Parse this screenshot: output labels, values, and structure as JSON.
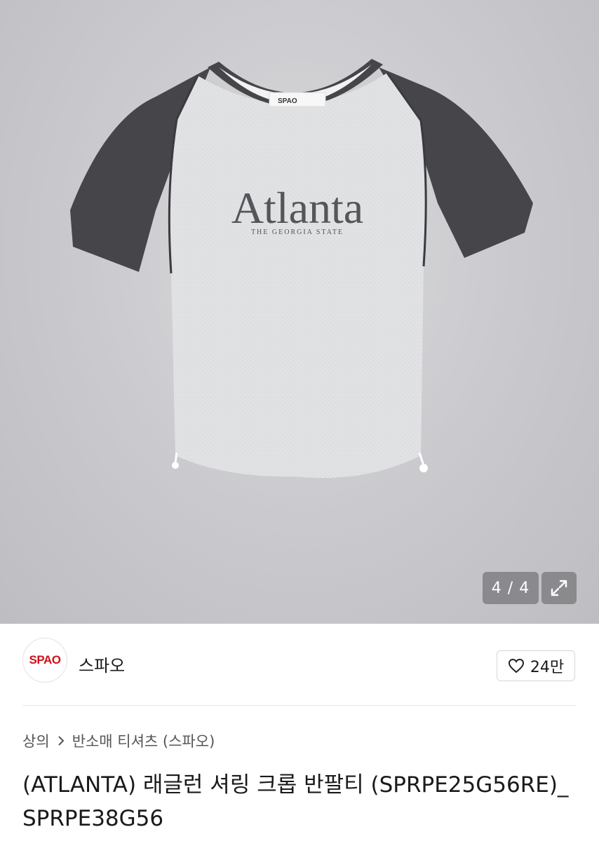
{
  "gallery": {
    "counter": "4 / 4",
    "print_title": "Atlanta",
    "print_subtitle": "THE GEORGIA STATE",
    "tag_brand": "SPAO",
    "expand_icon": "expand-arrows-icon"
  },
  "seller": {
    "logo_text": "SPAO",
    "name": "스파오",
    "like_count": "24만",
    "like_icon": "heart-outline-icon"
  },
  "breadcrumb": {
    "items": [
      "상의",
      "반소매 티셔츠 (스파오)"
    ],
    "separator_icon": "chevron-right-icon"
  },
  "product": {
    "title": "(ATLANTA) 래글런 셔링 크롭 반팔티 (SPRPE25G56RE)_SPRPE38G56"
  },
  "colors": {
    "brand_red": "#d0111b",
    "sleeve": "#45454a",
    "body": "#e2e3e5"
  }
}
